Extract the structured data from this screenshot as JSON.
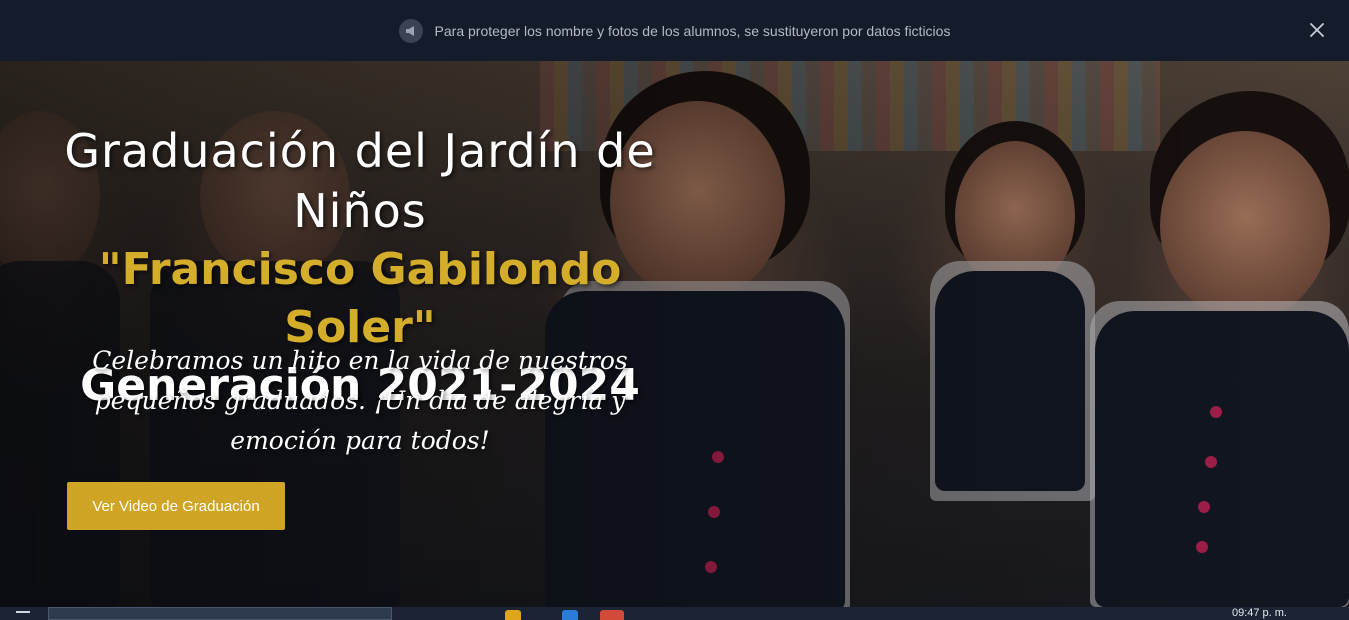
{
  "notice": {
    "icon": "megaphone-icon",
    "text": "Para proteger los nombre y fotos de los alumnos, se sustituyeron por datos ficticios",
    "close_icon": "close-icon"
  },
  "hero": {
    "title_line1": "Graduación del Jardín de Niños",
    "title_line2": "\"Francisco Gabilondo Soler\"",
    "title_line3": "Generación 2021-2024",
    "subtitle": "Celebramos un hito en la vida de nuestros pequeños graduados. ¡Un día de alegría y emoción para todos!",
    "cta_label": "Ver Video de Graduación",
    "accent_color": "#d0a425"
  },
  "taskbar": {
    "clock": "09:47 p. m."
  }
}
